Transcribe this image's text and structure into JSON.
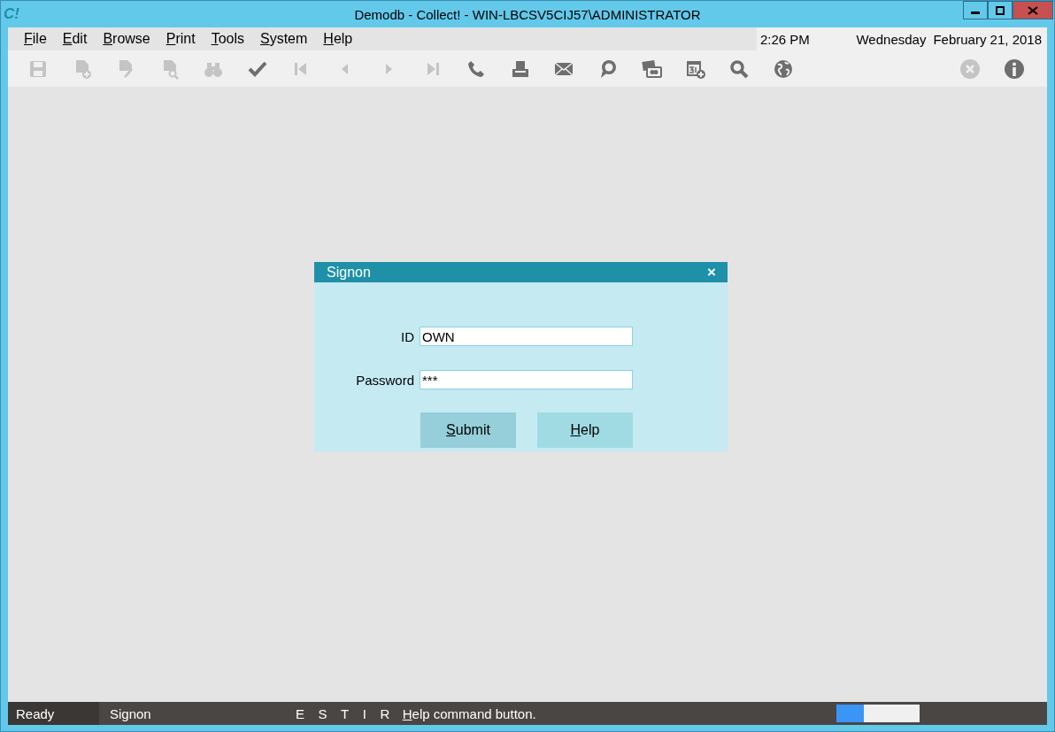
{
  "window": {
    "logo": "C!",
    "title": "Demodb - Collect! - WIN-LBCSV5CIJ57\\ADMINISTRATOR"
  },
  "menu": [
    "File",
    "Edit",
    "Browse",
    "Print",
    "Tools",
    "System",
    "Help"
  ],
  "clock": {
    "time": "2:26 PM",
    "day": "Wednesday",
    "date": "February 21, 2018"
  },
  "toolbar": [
    {
      "kind": "save",
      "disabled": true
    },
    {
      "kind": "new-doc",
      "disabled": true
    },
    {
      "kind": "edit-doc",
      "disabled": true
    },
    {
      "kind": "find-doc",
      "disabled": true
    },
    {
      "kind": "binoculars",
      "disabled": true
    },
    {
      "kind": "check",
      "disabled": false
    },
    {
      "kind": "first",
      "disabled": true
    },
    {
      "kind": "prev",
      "disabled": true
    },
    {
      "kind": "next",
      "disabled": true
    },
    {
      "kind": "last",
      "disabled": true
    },
    {
      "kind": "phone",
      "disabled": false
    },
    {
      "kind": "printer",
      "disabled": false
    },
    {
      "kind": "mail",
      "disabled": false
    },
    {
      "kind": "chat",
      "disabled": false
    },
    {
      "kind": "cards",
      "disabled": false
    },
    {
      "kind": "calendar",
      "disabled": false
    },
    {
      "kind": "search",
      "disabled": false
    },
    {
      "kind": "globe",
      "disabled": false
    }
  ],
  "toolbar_right": [
    {
      "kind": "cancel",
      "disabled": true
    },
    {
      "kind": "info",
      "disabled": false
    }
  ],
  "dialog": {
    "title": "Signon",
    "close": "×",
    "fields": [
      {
        "label": "ID",
        "value": "OWN"
      },
      {
        "label": "Password",
        "value": "***"
      }
    ],
    "buttons": [
      {
        "label": "Submit",
        "selected": true
      },
      {
        "label": "Help",
        "selected": false
      }
    ]
  },
  "status_bar": {
    "state": "Ready",
    "form": "Signon",
    "flags": [
      "E",
      "S",
      "T",
      "I",
      "R"
    ],
    "message": "Help command button.",
    "progress": {
      "level": 0.33
    }
  }
}
